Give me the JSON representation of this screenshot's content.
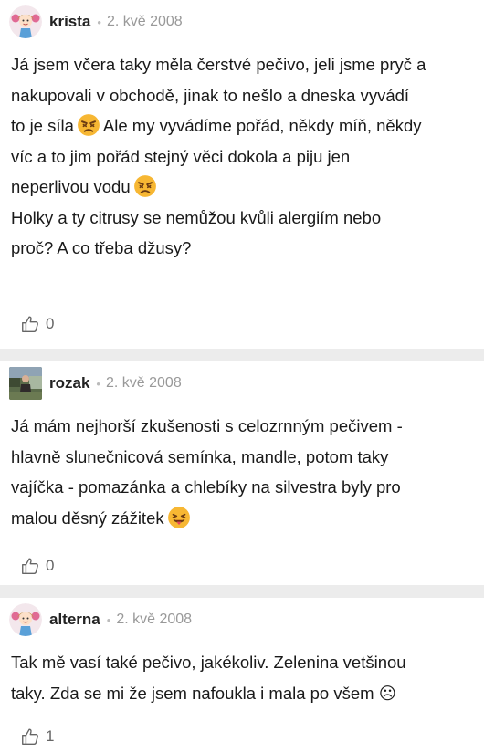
{
  "comments": [
    {
      "author": "krista",
      "separator": "•",
      "date": "2. kvě 2008",
      "body": {
        "l1": "Já jsem včera taky měla čerstvé pečivo, jeli jsme pryč a",
        "l2": "nakupovali v obchodě, jinak to nešlo a dneska vyvádí",
        "l3a": "to je síla",
        "l3b": "Ale my vyvádíme pořád, někdy míň, někdy",
        "l4": "víc a to jim pořád stejný věci dokola a piju jen",
        "l5": "neperlivou vodu",
        "l6": "Holky a ty citrusy se nemůžou kvůli alergiím nebo",
        "l7": "proč? A co třeba džusy?"
      },
      "emojis": [
        "angry-face-icon",
        "angry-face-icon"
      ],
      "likes": "0"
    },
    {
      "author": "rozak",
      "separator": "•",
      "date": "2. kvě 2008",
      "body": {
        "l1": "Já mám nejhorší zkušenosti s celozrnným pečivem -",
        "l2": "hlavně slunečnicová semínka, mandle, potom taky",
        "l3": "vajíčka - pomazánka a chlebíky na silvestra byly pro",
        "l4": "malou děsný zážitek"
      },
      "emojis": [
        "tongue-out-face-icon"
      ],
      "likes": "0"
    },
    {
      "author": "alterna",
      "separator": "•",
      "date": "2. kvě 2008",
      "body": {
        "l1": "Tak mě vasí také pečivo, jakékoliv. Zelenina vetšinou",
        "l2": "taky. Zda se mi že jsem nafoukla i mala po všem ☹"
      },
      "likes": "1"
    }
  ]
}
